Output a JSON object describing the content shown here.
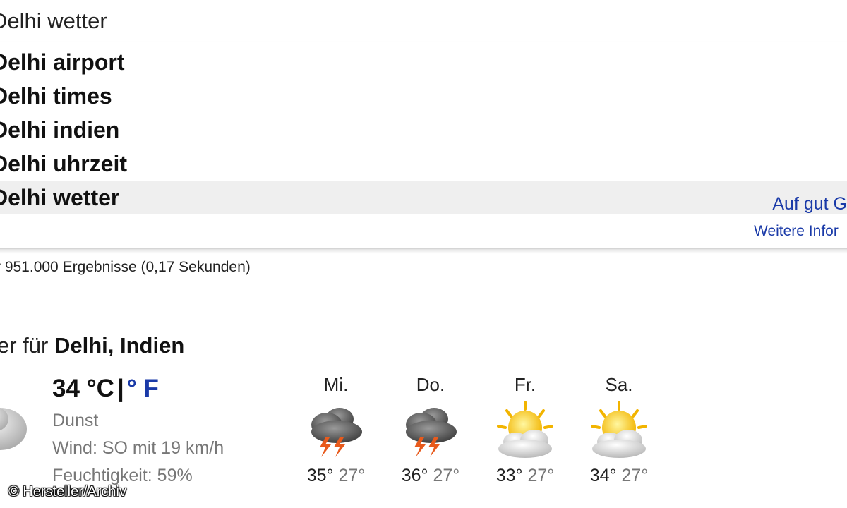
{
  "search": {
    "query": "Delhi wetter"
  },
  "suggestions": [
    {
      "text": "Delhi airport"
    },
    {
      "text": "Delhi times"
    },
    {
      "text": "Delhi indien"
    },
    {
      "text": "Delhi uhrzeit"
    },
    {
      "text": "Delhi wetter",
      "highlighted": true
    }
  ],
  "dropdown": {
    "lucky_label": "Auf gut G",
    "more_label": "Weitere Infor"
  },
  "results": {
    "stats": "r 951.000 Ergebnisse (0,17 Sekunden)"
  },
  "weather": {
    "title_prefix": "er für ",
    "location": "Delhi, Indien",
    "current": {
      "temp_c": "34 °C",
      "separator": "|",
      "unit_f": "° F",
      "condition": "Dunst",
      "wind": "Wind: SO mit 19 km/h",
      "humidity": "Feuchtigkeit: 59%",
      "icon": "haze-cloud-icon"
    },
    "forecast": [
      {
        "day": "Mi.",
        "icon": "thunderstorm-icon",
        "high": "35°",
        "low": "27°"
      },
      {
        "day": "Do.",
        "icon": "thunderstorm-icon",
        "high": "36°",
        "low": "27°"
      },
      {
        "day": "Fr.",
        "icon": "partly-sunny-icon",
        "high": "33°",
        "low": "27°"
      },
      {
        "day": "Sa.",
        "icon": "partly-sunny-icon",
        "high": "34°",
        "low": "27°"
      }
    ]
  },
  "copyright": "© Hersteller/Archiv",
  "colors": {
    "link": "#1a3aa8",
    "highlight_row": "#efefef",
    "muted_text": "#777777"
  }
}
